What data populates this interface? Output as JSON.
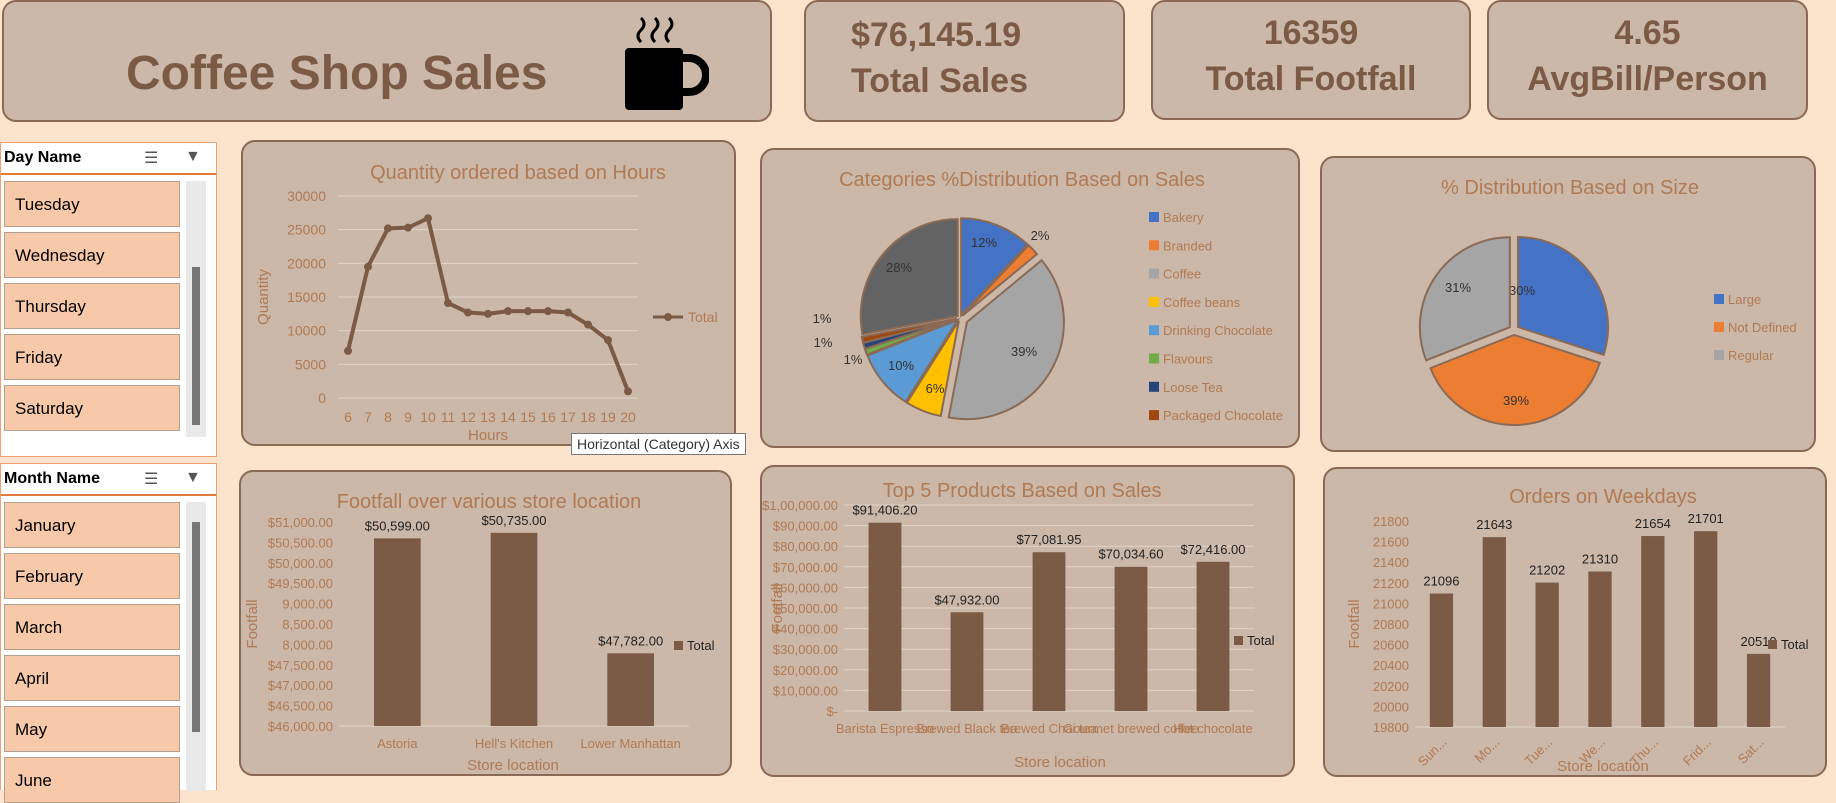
{
  "header": {
    "title": "Coffee Shop Sales",
    "icon": "coffee-cup-icon"
  },
  "kpis": [
    {
      "value": "$76,145.19",
      "label": "Total Sales"
    },
    {
      "value": "16359",
      "label": "Total Footfall"
    },
    {
      "value": "4.65",
      "label": "AvgBill/Person"
    }
  ],
  "slicers": {
    "day": {
      "title": "Day Name",
      "items": [
        "Tuesday",
        "Wednesday",
        "Thursday",
        "Friday",
        "Saturday"
      ]
    },
    "month": {
      "title": "Month Name",
      "items": [
        "January",
        "February",
        "March",
        "April",
        "May",
        "June"
      ]
    }
  },
  "tooltip": "Horizontal (Category) Axis",
  "colors": {
    "background": "#fbe3cc",
    "panel": "#cbb8a8",
    "border": "#8b6a55",
    "text": "#b07a55",
    "bar": "#7b5b46"
  },
  "chart_data": [
    {
      "id": "hours",
      "type": "line",
      "title": "Quantity ordered based on Hours",
      "xlabel": "Hours",
      "ylabel": "Quantity",
      "x": [
        6,
        7,
        8,
        9,
        10,
        11,
        12,
        13,
        14,
        15,
        16,
        17,
        18,
        19,
        20
      ],
      "series": [
        {
          "name": "Total",
          "values": [
            7000,
            19500,
            25200,
            25300,
            26700,
            14100,
            12700,
            12500,
            12900,
            12900,
            12900,
            12700,
            10900,
            8600,
            1000
          ]
        }
      ],
      "ylim": [
        0,
        30000
      ],
      "yticks": [
        0,
        5000,
        10000,
        15000,
        20000,
        25000,
        30000
      ],
      "legend": "right",
      "grid": true
    },
    {
      "id": "categories",
      "type": "pie",
      "title": "Categories %Distribution Based on Sales",
      "labels": [
        "Bakery",
        "Branded",
        "Coffee",
        "Coffee beans",
        "Drinking Chocolate",
        "Flavours",
        "Loose Tea",
        "Packaged Chocolate"
      ],
      "values": [
        12,
        2,
        39,
        6,
        10,
        1,
        1,
        1
      ],
      "remainder": {
        "value": 28,
        "label": "28%"
      },
      "slice_labels": [
        "12%",
        "2%",
        "39%",
        "6%",
        "10%",
        "1%",
        "1%",
        "1%"
      ],
      "colors": [
        "#4472c4",
        "#ed7d31",
        "#a5a5a5",
        "#ffc000",
        "#5b9bd5",
        "#70ad47",
        "#264478",
        "#9e480e",
        "#636363"
      ],
      "legend": "right"
    },
    {
      "id": "size",
      "type": "pie",
      "title": "% Distribution Based on Size",
      "labels": [
        "Large",
        "Not Defined",
        "Regular"
      ],
      "values": [
        30,
        39,
        31
      ],
      "slice_labels": [
        "30%",
        "39%",
        "31%"
      ],
      "colors": [
        "#4472c4",
        "#ed7d31",
        "#a5a5a5"
      ],
      "legend": "right"
    },
    {
      "id": "footfall",
      "type": "bar",
      "title": "Footfall over various store location",
      "xlabel": "Store location",
      "ylabel": "Footfall",
      "categories": [
        "Astoria",
        "Hell's Kitchen",
        "Lower Manhattan"
      ],
      "series": [
        {
          "name": "Total",
          "values": [
            50599,
            50735,
            47782
          ]
        }
      ],
      "data_labels": [
        "$50,599.00",
        "$50,735.00",
        "$47,782.00"
      ],
      "ylim": [
        46000,
        51000
      ],
      "ytick_labels": [
        "$46,000.00",
        "$46,500.00",
        "$47,000.00",
        "$47,500.00",
        "8,000.00",
        "8,500.00",
        "9,000.00",
        "$49,500.00",
        "$50,000.00",
        "$50,500.00",
        "$51,000.00"
      ],
      "legend": "right",
      "grid": false
    },
    {
      "id": "products",
      "type": "bar",
      "title": "Top 5 Products Based on Sales",
      "xlabel": "Store location",
      "ylabel": "Footfall",
      "categories": [
        "Barista Espresso",
        "Brewed Black tea",
        "Brewed Chai tea",
        "Gourmet brewed coffee",
        "Hot chocolate"
      ],
      "series": [
        {
          "name": "Total",
          "values": [
            91406.2,
            47932.0,
            77081.95,
            70034.6,
            72416.0
          ]
        }
      ],
      "data_labels": [
        "$91,406.20",
        "$47,932.00",
        "$77,081.95",
        "$70,034.60",
        "$72,416.00"
      ],
      "ylim": [
        0,
        100000
      ],
      "ytick_labels": [
        "$-",
        "$10,000.00",
        "$20,000.00",
        "$30,000.00",
        "$40,000.00",
        "$50,000.00",
        "$60,000.00",
        "$70,000.00",
        "$80,000.00",
        "$90,000.00",
        "$1,00,000.00"
      ],
      "legend": "right",
      "grid": true
    },
    {
      "id": "weekdays",
      "type": "bar",
      "title": "Orders on Weekdays",
      "xlabel": "Store location",
      "ylabel": "Footfall",
      "categories": [
        "Sun...",
        "Mo...",
        "Tue...",
        "We...",
        "Thu...",
        "Frid...",
        "Sat..."
      ],
      "series": [
        {
          "name": "Total",
          "values": [
            21096,
            21643,
            21202,
            21310,
            21654,
            21701,
            20510
          ]
        }
      ],
      "data_labels": [
        "21096",
        "21643",
        "21202",
        "21310",
        "21654",
        "21701",
        "20510"
      ],
      "ylim": [
        19800,
        21800
      ],
      "yticks": [
        19800,
        20000,
        20200,
        20400,
        20600,
        20800,
        21000,
        21200,
        21400,
        21600,
        21800
      ],
      "legend": "right",
      "grid": false
    }
  ]
}
